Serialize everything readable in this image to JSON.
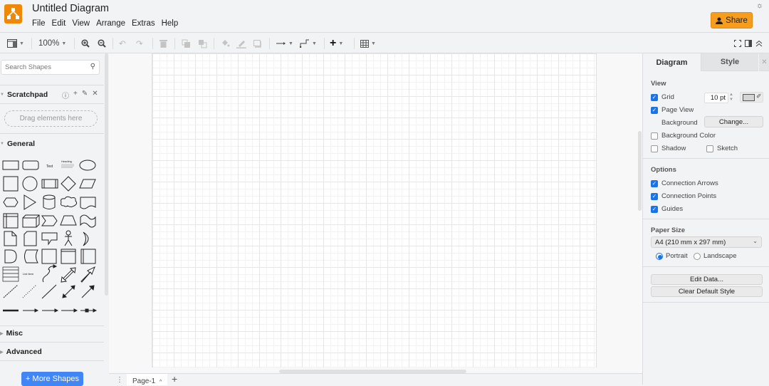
{
  "header": {
    "title": "Untitled Diagram",
    "menus": [
      "File",
      "Edit",
      "View",
      "Arrange",
      "Extras",
      "Help"
    ],
    "share_label": "Share",
    "theme_icon": "sun-icon",
    "brand_color": "#f08705",
    "share_color": "#f79d1e"
  },
  "toolbar": {
    "zoom_level": "100%",
    "items": [
      "format-panel-toggle",
      "zoom-dropdown",
      "zoom-in",
      "zoom-out",
      "undo",
      "redo",
      "delete",
      "to-front",
      "to-back",
      "fill-color",
      "line-color",
      "shadow",
      "connection-style",
      "waypoints",
      "insert",
      "table",
      "fullscreen",
      "toggle-format",
      "collapse"
    ]
  },
  "left_panel": {
    "search_placeholder": "Search Shapes",
    "scratchpad_label": "Scratchpad",
    "drag_hint": "Drag elements here",
    "general_label": "General",
    "misc_label": "Misc",
    "advanced_label": "Advanced",
    "more_shapes_label": "+ More Shapes",
    "shape_text_label": "Text",
    "shape_heading_label": "Heading",
    "shape_list_label": "List Item"
  },
  "canvas": {
    "page_tab": "Page-1",
    "page_tab_caret": "^"
  },
  "right_panel": {
    "tabs": [
      "Diagram",
      "Style"
    ],
    "view_heading": "View",
    "grid_label": "Grid",
    "grid_checked": true,
    "grid_size": "10 pt",
    "page_view_label": "Page View",
    "page_view_checked": true,
    "background_label": "Background",
    "change_label": "Change...",
    "background_color_label": "Background Color",
    "background_color_checked": false,
    "shadow_label": "Shadow",
    "shadow_checked": false,
    "sketch_label": "Sketch",
    "sketch_checked": false,
    "options_heading": "Options",
    "connection_arrows_label": "Connection Arrows",
    "connection_arrows_checked": true,
    "connection_points_label": "Connection Points",
    "connection_points_checked": true,
    "guides_label": "Guides",
    "guides_checked": true,
    "paper_size_heading": "Paper Size",
    "paper_size_value": "A4 (210 mm x 297 mm)",
    "portrait_label": "Portrait",
    "landscape_label": "Landscape",
    "orientation": "portrait",
    "edit_data_label": "Edit Data...",
    "clear_style_label": "Clear Default Style",
    "accent_color": "#1a73e8"
  }
}
